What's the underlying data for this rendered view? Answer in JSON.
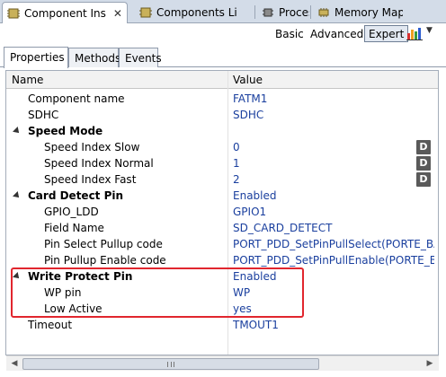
{
  "editor_tabs": [
    {
      "label": "Component Ins",
      "active": true
    },
    {
      "label": "Components Li",
      "active": false
    },
    {
      "label": "Processor",
      "active": false
    },
    {
      "label": "Memory Map",
      "active": false
    }
  ],
  "toolbar": {
    "basic": "Basic",
    "advanced": "Advanced",
    "expert": "Expert",
    "selected": "Expert"
  },
  "inner_tabs": [
    "Properties",
    "Methods",
    "Events"
  ],
  "table": {
    "headers": {
      "name": "Name",
      "value": "Value"
    },
    "rows": [
      {
        "name": "Component name",
        "value": "FATM1"
      },
      {
        "name": "SDHC",
        "value": "SDHC"
      },
      {
        "name": "Speed Mode",
        "value": ""
      },
      {
        "name": "Speed Index Slow",
        "value": "0",
        "button": "D"
      },
      {
        "name": "Speed Index Normal",
        "value": "1",
        "button": "D"
      },
      {
        "name": "Speed Index Fast",
        "value": "2",
        "button": "D"
      },
      {
        "name": "Card Detect Pin",
        "value": "Enabled"
      },
      {
        "name": "GPIO_LDD",
        "value": "GPIO1"
      },
      {
        "name": "Field Name",
        "value": "SD_CARD_DETECT"
      },
      {
        "name": "Pin Select Pullup code",
        "value": "PORT_PDD_SetPinPullSelect(PORTE_BA..."
      },
      {
        "name": "Pin Pullup Enable code",
        "value": "PORT_PDD_SetPinPullEnable(PORTE_B..."
      },
      {
        "name": "Write Protect Pin",
        "value": "Enabled"
      },
      {
        "name": "WP pin",
        "value": "WP"
      },
      {
        "name": "Low Active",
        "value": "yes"
      },
      {
        "name": "Timeout",
        "value": "TMOUT1"
      }
    ]
  },
  "colors": {
    "value_text": "#1a3f9e",
    "highlight": "#e1262e",
    "tab_strip": "#d3dce8"
  },
  "icons": [
    "component-icon",
    "chip-icon",
    "chart-icon",
    "close-icon",
    "expand-icon"
  ]
}
